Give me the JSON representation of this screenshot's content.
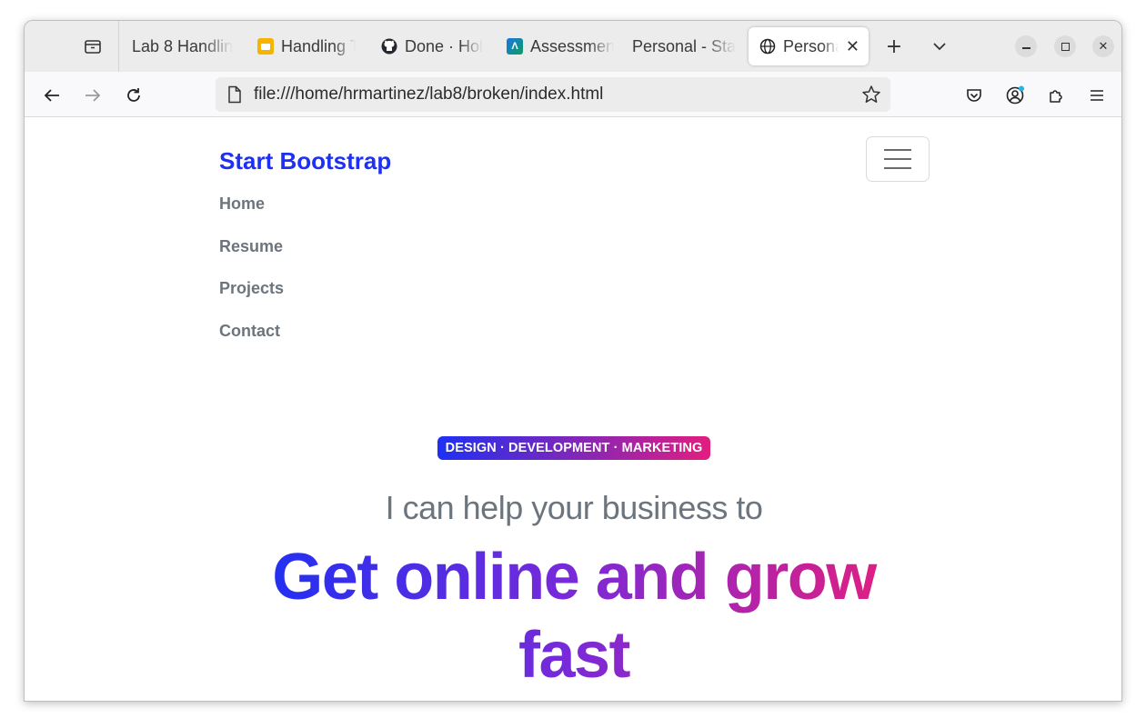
{
  "browser": {
    "tabs": [
      {
        "label": "Lab 8 Handlin",
        "icon": "none"
      },
      {
        "label": "Handling T",
        "icon": "slides-icon"
      },
      {
        "label": "Done · Hol",
        "icon": "github-icon"
      },
      {
        "label": "Assessmen",
        "icon": "canvas-icon"
      },
      {
        "label": "Personal - Sta",
        "icon": "none"
      },
      {
        "label": "Persona",
        "icon": "globe-icon",
        "active": true
      }
    ],
    "new_tab": "+",
    "url": "file:///home/hrmartinez/lab8/broken/index.html"
  },
  "page": {
    "brand": "Start Bootstrap",
    "nav": [
      "Home",
      "Resume",
      "Projects",
      "Contact"
    ],
    "badge": "DESIGN · DEVELOPMENT · MARKETING",
    "subhead": "I can help your business to",
    "headline": "Get online and grow fast",
    "colors": {
      "primary": "#1e30f3",
      "secondary": "#e21e80",
      "muted": "#6c757d"
    }
  }
}
